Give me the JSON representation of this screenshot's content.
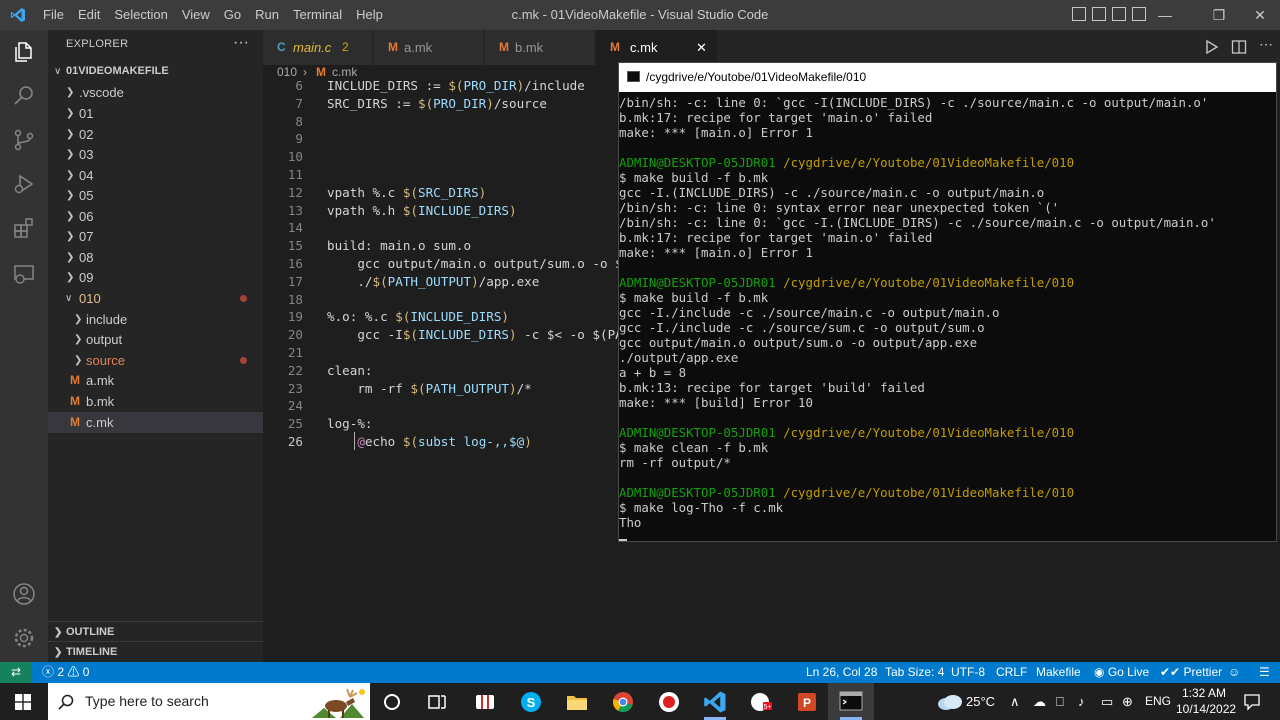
{
  "window": {
    "title": "c.mk - 01VideoMakefile - Visual Studio Code",
    "menu": [
      "File",
      "Edit",
      "Selection",
      "View",
      "Go",
      "Run",
      "Terminal",
      "Help"
    ]
  },
  "sidebar": {
    "title": "EXPLORER",
    "more": "···",
    "root": "01VIDEOMAKEFILE",
    "items": [
      ".vscode",
      "01",
      "02",
      "03",
      "04",
      "05",
      "06",
      "07",
      "08",
      "09",
      "010",
      "include",
      "output",
      "source",
      "a.mk",
      "b.mk",
      "c.mk"
    ],
    "file_icon": "M",
    "outline": "OUTLINE",
    "timeline": "TIMELINE"
  },
  "tabs": [
    {
      "icon": "C",
      "label": "main.c",
      "badge": "2"
    },
    {
      "icon": "M",
      "label": "a.mk"
    },
    {
      "icon": "M",
      "label": "b.mk"
    },
    {
      "icon": "M",
      "label": "c.mk",
      "close": "✕"
    }
  ],
  "breadcrumb": {
    "folder": "010",
    "sep": "›",
    "icon": "M",
    "file": "c.mk"
  },
  "editor": {
    "line_numbers": [
      "6",
      "7",
      "8",
      "9",
      "10",
      "11",
      "12",
      "13",
      "14",
      "15",
      "16",
      "17",
      "18",
      "19",
      "20",
      "21",
      "22",
      "23",
      "24",
      "25",
      "26"
    ],
    "lines": [
      "INCLUDE_DIRS := $(PRO_DIR)/include",
      "SRC_DIRS := $(PRO_DIR)/source",
      "",
      "",
      "",
      "",
      "vpath %.c $(SRC_DIRS)",
      "vpath %.h $(INCLUDE_DIRS)",
      "",
      "build: main.o sum.o",
      "    gcc output/main.o output/sum.o -o $(P",
      "    ./$(PATH_OUTPUT)/app.exe",
      "",
      "%.o: %.c $(INCLUDE_DIRS)",
      "    gcc -I$(INCLUDE_DIRS) -c $< -o $(PATH",
      "",
      "clean:",
      "    rm -rf $(PATH_OUTPUT)/*",
      "",
      "log-%:",
      "    @echo $(subst log-,,$@)"
    ]
  },
  "terminal": {
    "title": "/cygdrive/e/Youtobe/01VideoMakefile/010",
    "lines": [
      "/bin/sh: -c: line 0: `gcc -I(INCLUDE_DIRS) -c ./source/main.c -o output/main.o'",
      "b.mk:17: recipe for target 'main.o' failed",
      "make: *** [main.o] Error 1",
      "",
      "ADMIN@DESKTOP-05JDR01 /cygdrive/e/Youtobe/01VideoMakefile/010",
      "$ make build -f b.mk",
      "gcc -I.(INCLUDE_DIRS) -c ./source/main.c -o output/main.o",
      "/bin/sh: -c: line 0: syntax error near unexpected token `('",
      "/bin/sh: -c: line 0: `gcc -I.(INCLUDE_DIRS) -c ./source/main.c -o output/main.o'",
      "b.mk:17: recipe for target 'main.o' failed",
      "make: *** [main.o] Error 1",
      "",
      "ADMIN@DESKTOP-05JDR01 /cygdrive/e/Youtobe/01VideoMakefile/010",
      "$ make build -f b.mk",
      "gcc -I./include -c ./source/main.c -o output/main.o",
      "gcc -I./include -c ./source/sum.c -o output/sum.o",
      "gcc output/main.o output/sum.o -o output/app.exe",
      "./output/app.exe",
      "a + b = 8",
      "b.mk:13: recipe for target 'build' failed",
      "make: *** [build] Error 10",
      "",
      "ADMIN@DESKTOP-05JDR01 /cygdrive/e/Youtobe/01VideoMakefile/010",
      "$ make clean -f b.mk",
      "rm -rf output/*",
      "",
      "ADMIN@DESKTOP-05JDR01 /cygdrive/e/Youtobe/01VideoMakefile/010",
      "$ make log-Tho -f c.mk",
      "Tho"
    ],
    "prompt_user": "ADMIN@DESKTOP-05JDR01",
    "prompt_path": "/cygdrive/e/Youtobe/01VideoMakefile/010"
  },
  "statusbar": {
    "remote": "⇄",
    "errors": "2",
    "warnings": "0",
    "position": "Ln 26, Col 28",
    "tab_size": "Tab Size: 4",
    "encoding": "UTF-8",
    "eol": "CRLF",
    "language": "Makefile",
    "golive": "Go Live",
    "prettier": "Prettier"
  },
  "taskbar": {
    "search_placeholder": "Type here to search",
    "weather": "25°C",
    "lang": "ENG",
    "time": "1:32 AM",
    "date": "10/14/2022"
  },
  "colors": {
    "accent": "#007acc",
    "terminal_green": "#13a10e",
    "terminal_yellow": "#c19c00",
    "makefile_icon": "#e37933"
  }
}
